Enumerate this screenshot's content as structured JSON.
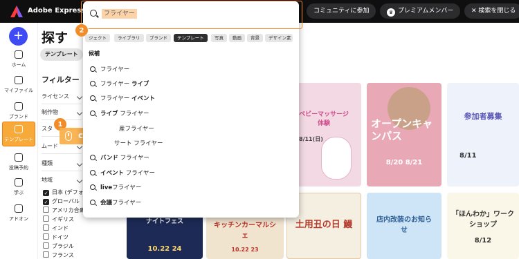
{
  "app": {
    "name": "Adobe Express"
  },
  "topbar": {
    "community_label": "コミュニティに参加",
    "premium_label": "プレミアムメンバー",
    "close_search_label": "検索を閉じる"
  },
  "rail": {
    "items": [
      {
        "label": "ホーム",
        "icon": "home-icon"
      },
      {
        "label": "マイファイル",
        "icon": "folder-icon"
      },
      {
        "label": "ブランド",
        "icon": "brand-icon"
      },
      {
        "label": "テンプレート",
        "icon": "template-icon"
      },
      {
        "label": "投稿予約",
        "icon": "calendar-icon"
      },
      {
        "label": "学ぶ",
        "icon": "learn-icon"
      },
      {
        "label": "アドオン",
        "icon": "addon-icon"
      }
    ]
  },
  "main": {
    "title": "探す",
    "template_chip": "テンプレート",
    "filter_title": "フィルター",
    "filters": [
      "ライセンス",
      "制作物",
      "スタ",
      "ムード",
      "種類",
      "地域"
    ],
    "languages": [
      {
        "label": "日本 (デフォル",
        "checked": true
      },
      {
        "label": "グローバル",
        "checked": true
      },
      {
        "label": "アメリカ合衆",
        "checked": false
      },
      {
        "label": "イギリス",
        "checked": false
      },
      {
        "label": "インド",
        "checked": false
      },
      {
        "label": "ドイツ",
        "checked": false
      },
      {
        "label": "ブラジル",
        "checked": false
      },
      {
        "label": "フランス",
        "checked": false
      }
    ]
  },
  "search": {
    "query": "フライヤー",
    "types": [
      "ジェクト",
      "ライブラリ",
      "ブランド",
      "テンプレート",
      "写真",
      "動画",
      "背景",
      "デザイン素"
    ],
    "suggestions_title": "候補",
    "suggestions": [
      {
        "pre": "フライヤー",
        "bold": "",
        "post": ""
      },
      {
        "pre": "フライヤー ",
        "bold": "ライブ",
        "post": ""
      },
      {
        "pre": "フライヤー ",
        "bold": "イベント",
        "post": ""
      },
      {
        "pre": "",
        "bold": "ライブ",
        "post": " フライヤー"
      },
      {
        "pre": "",
        "bold": "",
        "post": "産フライヤー"
      },
      {
        "pre": "",
        "bold": "",
        "post": "サート フライヤー"
      },
      {
        "pre": "",
        "bold": "バンド",
        "post": " フライヤー"
      },
      {
        "pre": "",
        "bold": "イベント",
        "post": " フライヤー"
      },
      {
        "pre": "",
        "bold": "live",
        "post": "フライヤー"
      },
      {
        "pre": "",
        "bold": "会議",
        "post": "フライヤー"
      }
    ]
  },
  "thumbnails": [
    {
      "label": "ベビーマッサージ体験",
      "date": "8/11(日)",
      "bg": "#f3d9e4",
      "fg": "#d24d8c"
    },
    {
      "label": "オープンキャンパス",
      "date": "8/20 8/21",
      "bg": "#e9a8b6",
      "fg": "#ffffff"
    },
    {
      "label": "参加者募集",
      "date": "8/11",
      "bg": "#eef2fb",
      "fg": "#5b56b5"
    },
    {
      "label": "ナイトフェス",
      "date": "10.22 24",
      "bg": "#1c2a55",
      "fg": "#ffffff"
    },
    {
      "label": "キッチンカーマルシェ",
      "date": "10.22 23",
      "bg": "#f1e4cf",
      "fg": "#b8322a"
    },
    {
      "label": "土用丑の日 鰻",
      "date": "",
      "bg": "#f5efe2",
      "fg": "#b43a2b"
    },
    {
      "label": "店内改装のお知らせ",
      "date": "",
      "bg": "#cde5f6",
      "fg": "#2f5f98"
    },
    {
      "label": "「ほんわか」ワークショップ",
      "date": "8/12",
      "bg": "#fbf7e8",
      "fg": "#333333"
    }
  ],
  "annotations": {
    "step1": "1",
    "step2": "2",
    "click_label": "click"
  },
  "colors": {
    "accent": "#f28c28",
    "brand_blue": "#3e4bf5",
    "topbar": "#0f0f10"
  }
}
